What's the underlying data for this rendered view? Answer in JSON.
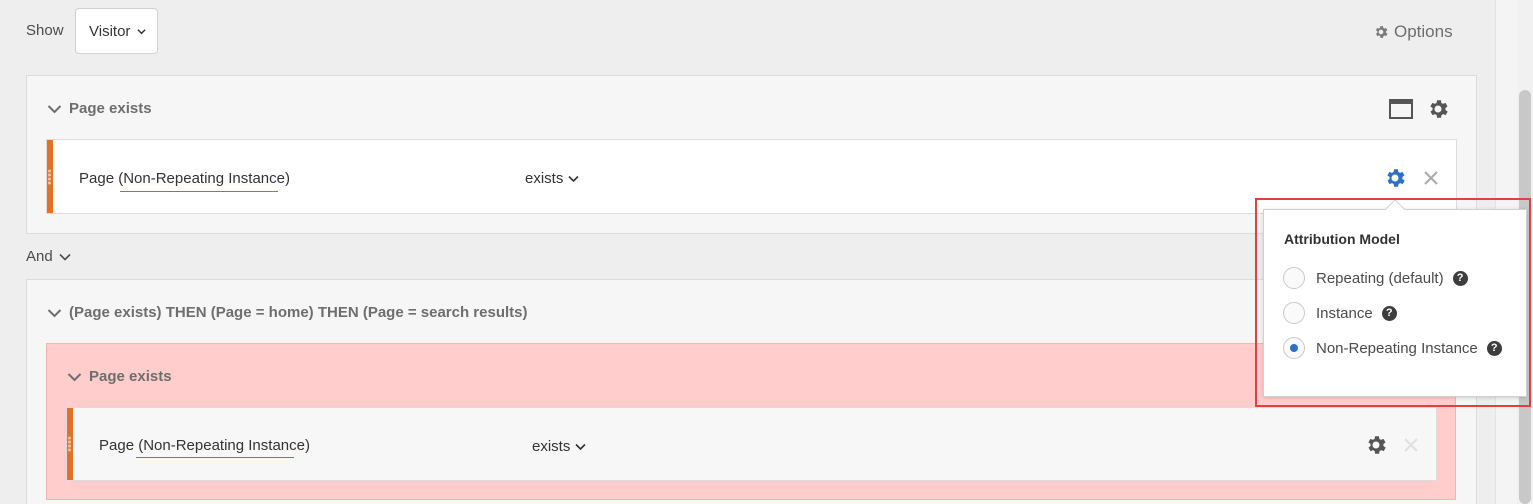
{
  "toolbar": {
    "show_label": "Show",
    "show_value": "Visitor",
    "options_label": "Options"
  },
  "container1": {
    "title": "Page exists",
    "rule": {
      "dimension": "Page (Non-Repeating Instance)",
      "operator": "exists"
    }
  },
  "logic": {
    "operator": "And"
  },
  "container2": {
    "title": "(Page exists) THEN (Page = home) THEN (Page = search results)",
    "nested": {
      "title": "Page exists",
      "rule": {
        "dimension": "Page (Non-Repeating Instance)",
        "operator": "exists"
      }
    }
  },
  "attribution_popover": {
    "title": "Attribution Model",
    "options": [
      {
        "label": "Repeating (default)",
        "checked": false
      },
      {
        "label": "Instance",
        "checked": false
      },
      {
        "label": "Non-Repeating Instance",
        "checked": true
      }
    ]
  },
  "colors": {
    "accent_orange": "#e37229",
    "highlight_red": "#e0403f",
    "gear_active_blue": "#2d6fc7",
    "pink_background": "#ffcdcb"
  }
}
